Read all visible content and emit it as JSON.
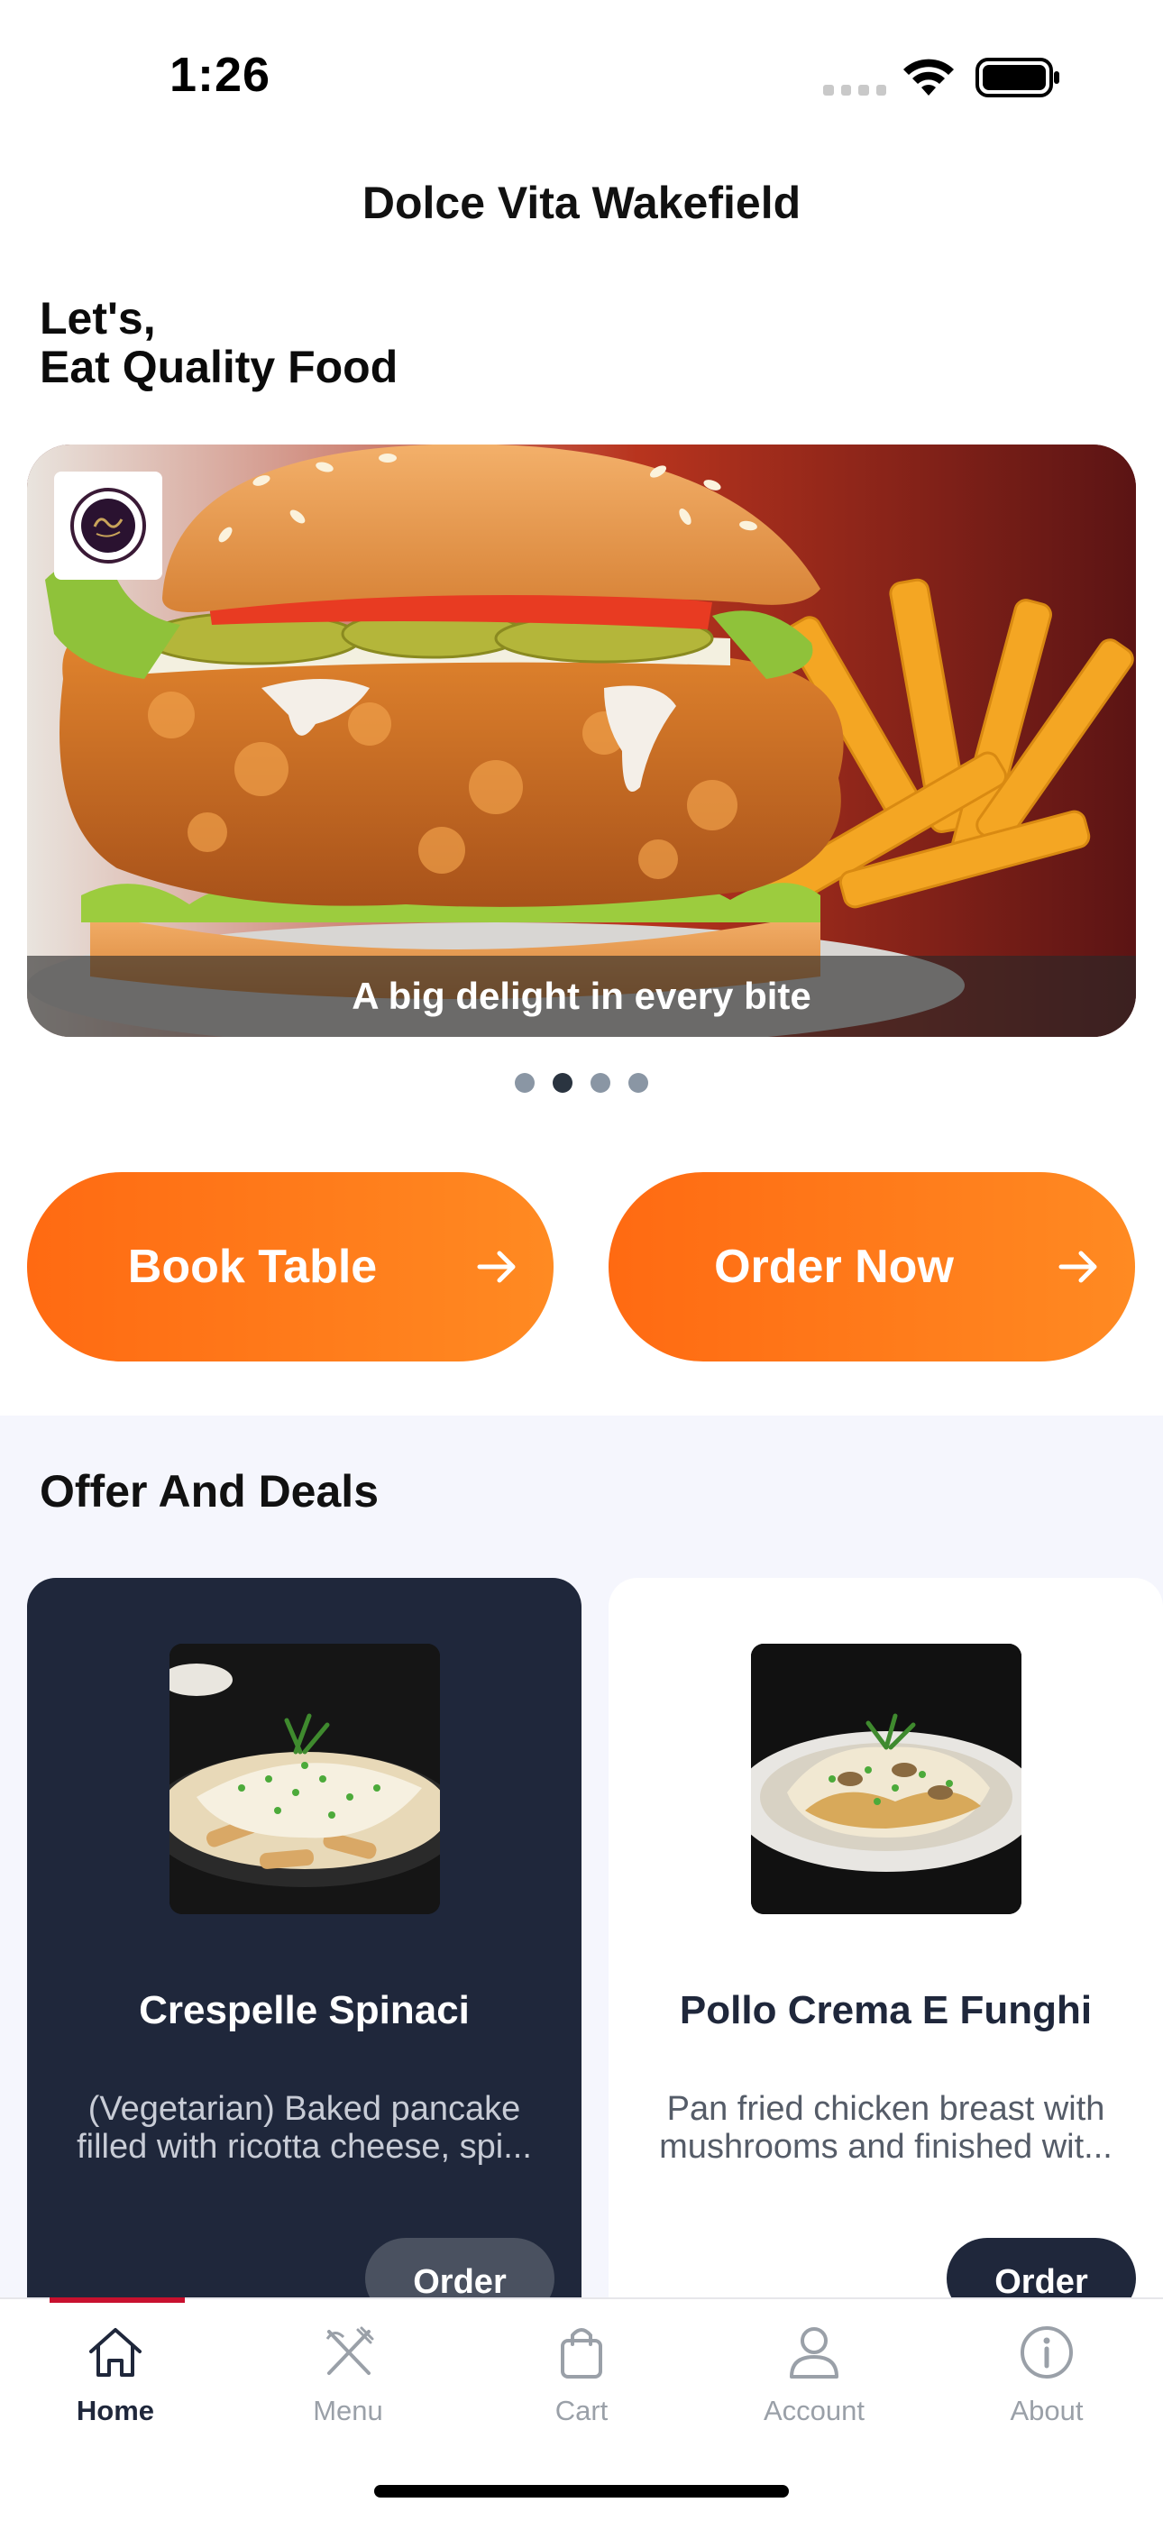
{
  "status_bar": {
    "time": "1:26"
  },
  "header": {
    "title": "Dolce Vita Wakefield"
  },
  "greeting": {
    "line1": "Let's,",
    "line2": "Eat Quality Food"
  },
  "carousel": {
    "caption": "A big delight in every bite",
    "slide_count": 4,
    "active_index": 1
  },
  "actions": {
    "book_label": "Book Table",
    "order_label": "Order Now"
  },
  "offers": {
    "title": "Offer And Deals",
    "items": [
      {
        "name": "Crespelle Spinaci",
        "description": "(Vegetarian) Baked pancake filled with ricotta cheese, spi...",
        "button": "Order"
      },
      {
        "name": "Pollo Crema E Funghi",
        "description": "Pan fried chicken breast with mushrooms and finished wit...",
        "button": "Order"
      }
    ]
  },
  "nav": {
    "items": [
      {
        "label": "Home",
        "icon": "home-icon"
      },
      {
        "label": "Menu",
        "icon": "fork-knife-icon"
      },
      {
        "label": "Cart",
        "icon": "shopping-bag-icon"
      },
      {
        "label": "Account",
        "icon": "user-icon"
      },
      {
        "label": "About",
        "icon": "info-icon"
      }
    ],
    "active_index": 0
  },
  "colors": {
    "accent_orange": "#ff6a12",
    "navy": "#1f273b",
    "nav_active_indicator": "#c8102e",
    "section_bg": "#f5f6fd"
  }
}
